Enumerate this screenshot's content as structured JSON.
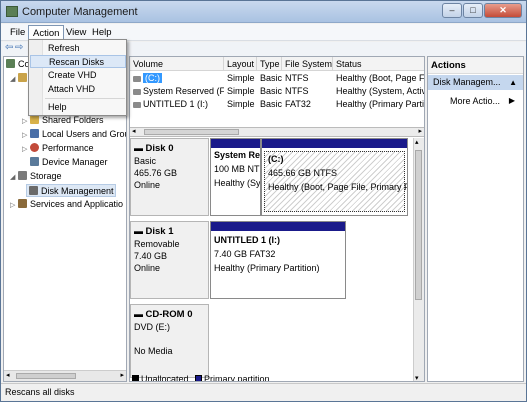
{
  "window": {
    "title": "Computer Management",
    "min": "–",
    "max": "□",
    "close": "✕"
  },
  "menu": {
    "file": "File",
    "action": "Action",
    "view": "View",
    "help": "Help"
  },
  "action_menu": {
    "items": [
      "Refresh",
      "Rescan Disks",
      "Create VHD",
      "Attach VHD",
      "Help"
    ]
  },
  "tree": {
    "root_partial": "Co",
    "items": [
      {
        "label": "Shared Folders",
        "icon": "folder-icon",
        "color": "#d9b24a"
      },
      {
        "label": "Local Users and Group",
        "icon": "users-icon",
        "color": "#4a6fa8"
      },
      {
        "label": "Performance",
        "icon": "performance-icon",
        "color": "#c24a3a"
      },
      {
        "label": "Device Manager",
        "icon": "device-manager-icon",
        "color": "#5a7a9a"
      },
      {
        "label": "Storage",
        "icon": "storage-icon",
        "color": "#7a7a7a"
      },
      {
        "label": "Disk Management",
        "icon": "disk-icon",
        "color": "#6a6a6a"
      },
      {
        "label": "Services and Applicatio",
        "icon": "services-icon",
        "color": "#8a6a3a"
      }
    ]
  },
  "volumes": {
    "headers": [
      "Volume",
      "Layout",
      "Type",
      "File System",
      "Status"
    ],
    "rows": [
      [
        "(C:)",
        "Simple",
        "Basic",
        "NTFS",
        "Healthy (Boot, Page F"
      ],
      [
        "System Reserved (F:)",
        "Simple",
        "Basic",
        "NTFS",
        "Healthy (System, Activ"
      ],
      [
        "UNTITLED 1 (I:)",
        "Simple",
        "Basic",
        "FAT32",
        "Healthy (Primary Partit"
      ]
    ]
  },
  "disks": [
    {
      "name": "Disk 0",
      "kind": "Basic",
      "size": "465.76 GB",
      "state": "Online",
      "partitions": [
        {
          "title": "System Re",
          "line1": "100 MB NT",
          "line2": "Healthy (Sy"
        },
        {
          "title": "(C:)",
          "line1": "465.66 GB NTFS",
          "line2": "Healthy (Boot, Page File, Primary Pa"
        }
      ]
    },
    {
      "name": "Disk 1",
      "kind": "Removable",
      "size": "7.40 GB",
      "state": "Online",
      "partitions": [
        {
          "title": "UNTITLED 1  (I:)",
          "line1": "7.40 GB FAT32",
          "line2": "Healthy (Primary Partition)"
        }
      ]
    },
    {
      "name": "CD-ROM 0",
      "kind": "DVD (E:)",
      "size": "",
      "state": "No Media"
    }
  ],
  "legend": {
    "unallocated": "Unallocated",
    "primary": "Primary partition",
    "unallocated_color": "#000000",
    "primary_color": "#1a1a8a"
  },
  "actions": {
    "header": "Actions",
    "sub": "Disk Managem...",
    "more": "More Actio..."
  },
  "status": "Rescans all disks"
}
